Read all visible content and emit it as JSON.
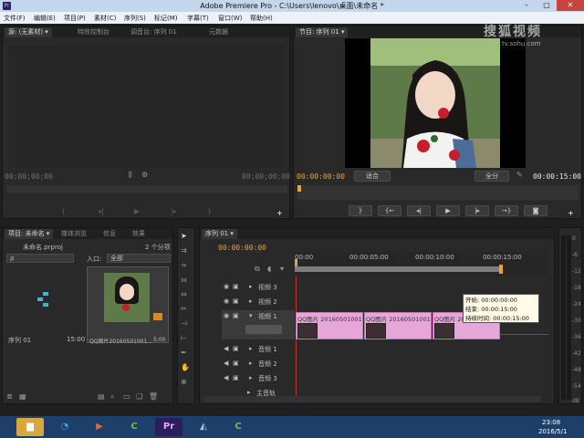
{
  "window": {
    "title": "Adobe Premiere Pro - C:\\Users\\lenovo\\桌面\\未命名 *",
    "app_icon": "Pr",
    "controls": [
      "–",
      "□",
      "✕"
    ]
  },
  "watermark": {
    "text": "搜狐视频",
    "url": "tv.sohu.com"
  },
  "menu": [
    "文件(F)",
    "编辑(E)",
    "项目(P)",
    "素材(C)",
    "序列(S)",
    "标记(M)",
    "字幕(T)",
    "窗口(W)",
    "帮助(H)"
  ],
  "source_panel": {
    "tabs": [
      "源: (无素材) ▾",
      "特效控制台",
      "调音台: 序列 01",
      "元数据"
    ],
    "timecode_left": "00;00;00;00",
    "timecode_right": "00;00;00;00"
  },
  "program_panel": {
    "tab": "节目: 序列 01 ▾",
    "timecode_left": "00:00:00:00",
    "fit_label": "适合",
    "quality_label": "全分",
    "timecode_right": "00:00:15:00"
  },
  "project_panel": {
    "tabs": [
      "项目: 未命名 ▾",
      "媒体浏览",
      "信息",
      "效果"
    ],
    "project_file": "未命名.prproj",
    "item_count": "2 个分项",
    "search_placeholder": "ρ",
    "entry_label": "入口:",
    "entry_value": "全部",
    "items": [
      {
        "name": "序列 01",
        "duration": "15:00"
      },
      {
        "name": "QQ图片20160501001...",
        "duration": "5:00"
      }
    ]
  },
  "timeline": {
    "tab": "序列 01 ▾",
    "timecode": "00:00:00:00",
    "ruler": [
      "00:00",
      "00:00:05:00",
      "00:00:10:00",
      "00:00:15:00"
    ],
    "video_tracks": [
      "视频 3",
      "视频 2",
      "视频 1"
    ],
    "audio_tracks": [
      "音频 1",
      "音频 2",
      "音频 3"
    ],
    "master_track": "主音轨",
    "clips": [
      {
        "label": "QQ图片 20160501001"
      },
      {
        "label": "QQ图片 20160501001"
      },
      {
        "label": "QQ图片 20160501"
      }
    ],
    "tooltip": {
      "start": "开始: 00:00:00:00",
      "end": "结束: 00:00:15:00",
      "duration": "持续时间: 00:00:15:00"
    }
  },
  "meter_labels": [
    "0",
    "-6",
    "-12",
    "-18",
    "-24",
    "-30",
    "-36",
    "-42",
    "-48",
    "-54",
    "dB"
  ],
  "taskbar": {
    "clock_time": "23:08",
    "clock_date": "2016/5/1",
    "apps": [
      "folder",
      "qq",
      "media-player",
      "camtasia",
      "premiere",
      "vs",
      "camtasia2"
    ]
  },
  "colors": {
    "accent_orange": "#e8a23a",
    "clip_pink": "#e6a7d8",
    "taskbar": "#1f3f6b",
    "title_bar": "#c4d6ea"
  }
}
